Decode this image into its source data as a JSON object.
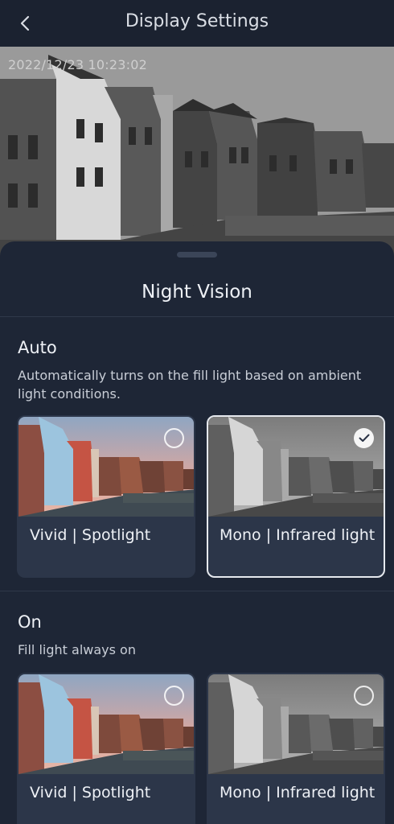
{
  "header": {
    "title": "Display Settings",
    "back_icon": "back-chevron-icon"
  },
  "preview": {
    "timestamp": "2022/12/23 10:23:02"
  },
  "sheet": {
    "title": "Night Vision",
    "sections": [
      {
        "title": "Auto",
        "description": "Automatically turns on the fill light based on ambient light conditions.",
        "options": [
          {
            "label": "Vivid | Spotlight",
            "selected": false
          },
          {
            "label": "Mono | Infrared light",
            "selected": true
          }
        ]
      },
      {
        "title": "On",
        "description": "Fill light always on",
        "options": [
          {
            "label": "Vivid | Spotlight",
            "selected": false
          },
          {
            "label": "Mono | Infrared light",
            "selected": false
          }
        ]
      }
    ]
  },
  "colors": {
    "background": "#1b2230",
    "sheet": "#1e2636",
    "card": "#2c3649",
    "accent": "#e6e9ee"
  }
}
